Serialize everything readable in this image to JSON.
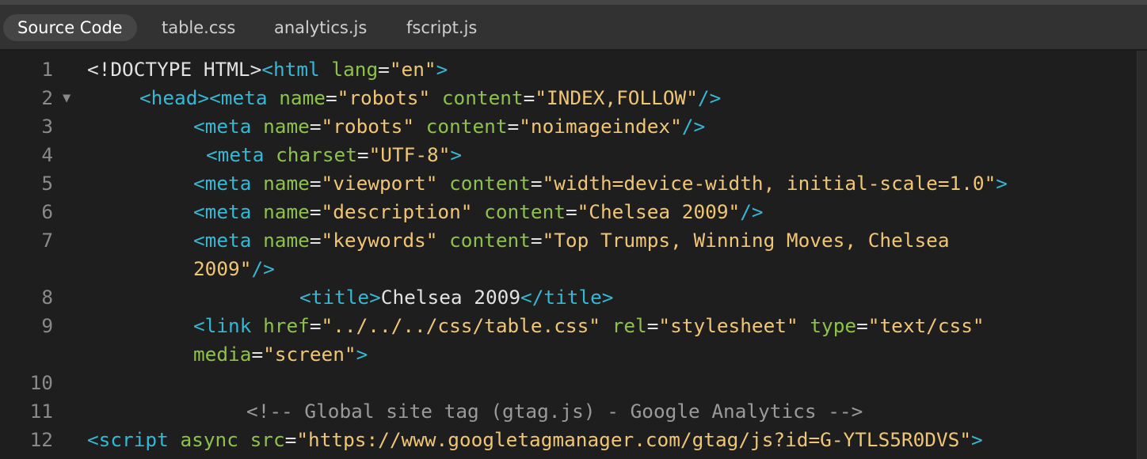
{
  "tabs": [
    {
      "label": "Source Code",
      "active": true
    },
    {
      "label": "table.css",
      "active": false
    },
    {
      "label": "analytics.js",
      "active": false
    },
    {
      "label": "fscript.js",
      "active": false
    }
  ],
  "colors": {
    "background": "#1e1e1e",
    "tag": "#33b8d6",
    "attribute_name": "#8dc24a",
    "attribute_value": "#f0c674",
    "text": "#e2e2e2",
    "comment": "#9a9a9a",
    "line_number": "#8a8a8a"
  },
  "editor": {
    "lines": [
      {
        "number": "1",
        "tokens": [
          {
            "t": "tx",
            "v": "<!DOCTYPE HTML>"
          },
          {
            "t": "tg",
            "v": "<html "
          },
          {
            "t": "an",
            "v": "lang"
          },
          {
            "t": "tx",
            "v": "="
          },
          {
            "t": "av",
            "v": "\"en\""
          },
          {
            "t": "tg",
            "v": ">"
          }
        ]
      },
      {
        "number": "2",
        "fold": "▼",
        "tokens": [
          {
            "t": "tg",
            "v": "<head><meta "
          },
          {
            "t": "an",
            "v": "name"
          },
          {
            "t": "tx",
            "v": "="
          },
          {
            "t": "av",
            "v": "\"robots\" "
          },
          {
            "t": "an",
            "v": "content"
          },
          {
            "t": "tx",
            "v": "="
          },
          {
            "t": "av",
            "v": "\"INDEX,FOLLOW\""
          },
          {
            "t": "tg",
            "v": "/>"
          }
        ]
      },
      {
        "number": "3",
        "tokens": [
          {
            "t": "tg",
            "v": "<meta "
          },
          {
            "t": "an",
            "v": "name"
          },
          {
            "t": "tx",
            "v": "="
          },
          {
            "t": "av",
            "v": "\"robots\" "
          },
          {
            "t": "an",
            "v": "content"
          },
          {
            "t": "tx",
            "v": "="
          },
          {
            "t": "av",
            "v": "\"noimageindex\""
          },
          {
            "t": "tg",
            "v": "/>"
          }
        ]
      },
      {
        "number": "4",
        "tokens": [
          {
            "t": "tg",
            "v": "<meta "
          },
          {
            "t": "an",
            "v": "charset"
          },
          {
            "t": "tx",
            "v": "="
          },
          {
            "t": "av",
            "v": "\"UTF-8\""
          },
          {
            "t": "tg",
            "v": ">"
          }
        ]
      },
      {
        "number": "5",
        "tokens": [
          {
            "t": "tg",
            "v": "<meta "
          },
          {
            "t": "an",
            "v": "name"
          },
          {
            "t": "tx",
            "v": "="
          },
          {
            "t": "av",
            "v": "\"viewport\" "
          },
          {
            "t": "an",
            "v": "content"
          },
          {
            "t": "tx",
            "v": "="
          },
          {
            "t": "av",
            "v": "\"width=device-width, initial-scale=1.0\""
          },
          {
            "t": "tg",
            "v": ">"
          }
        ]
      },
      {
        "number": "6",
        "tokens": [
          {
            "t": "tg",
            "v": "<meta "
          },
          {
            "t": "an",
            "v": "name"
          },
          {
            "t": "tx",
            "v": "="
          },
          {
            "t": "av",
            "v": "\"description\" "
          },
          {
            "t": "an",
            "v": "content"
          },
          {
            "t": "tx",
            "v": "="
          },
          {
            "t": "av",
            "v": "\"Chelsea 2009\""
          },
          {
            "t": "tg",
            "v": "/>"
          }
        ]
      },
      {
        "number": "7",
        "tokens": [
          {
            "t": "tg",
            "v": "<meta "
          },
          {
            "t": "an",
            "v": "name"
          },
          {
            "t": "tx",
            "v": "="
          },
          {
            "t": "av",
            "v": "\"keywords\" "
          },
          {
            "t": "an",
            "v": "content"
          },
          {
            "t": "tx",
            "v": "="
          },
          {
            "t": "av",
            "v": "\"Top Trumps, Winning Moves, Chelsea"
          }
        ]
      },
      {
        "number": "",
        "tokens": [
          {
            "t": "av",
            "v": "2009\""
          },
          {
            "t": "tg",
            "v": "/>"
          }
        ]
      },
      {
        "number": "8",
        "tokens": [
          {
            "t": "tg",
            "v": "<title>"
          },
          {
            "t": "tx",
            "v": "Chelsea 2009"
          },
          {
            "t": "tg",
            "v": "</title>"
          }
        ]
      },
      {
        "number": "9",
        "tokens": [
          {
            "t": "tg",
            "v": "<link "
          },
          {
            "t": "an",
            "v": "href"
          },
          {
            "t": "tx",
            "v": "="
          },
          {
            "t": "av",
            "v": "\"../../../css/table.css\" "
          },
          {
            "t": "an",
            "v": "rel"
          },
          {
            "t": "tx",
            "v": "="
          },
          {
            "t": "av",
            "v": "\"stylesheet\" "
          },
          {
            "t": "an",
            "v": "type"
          },
          {
            "t": "tx",
            "v": "="
          },
          {
            "t": "av",
            "v": "\"text/css\""
          }
        ]
      },
      {
        "number": "",
        "tokens": [
          {
            "t": "an",
            "v": "media"
          },
          {
            "t": "tx",
            "v": "="
          },
          {
            "t": "av",
            "v": "\"screen\""
          },
          {
            "t": "tg",
            "v": ">"
          }
        ]
      },
      {
        "number": "10",
        "tokens": []
      },
      {
        "number": "11",
        "tokens": [
          {
            "t": "cm",
            "v": "<!-- Global site tag (gtag.js) - Google Analytics -->"
          }
        ]
      },
      {
        "number": "12",
        "tokens": [
          {
            "t": "tg",
            "v": "<script "
          },
          {
            "t": "an",
            "v": "async "
          },
          {
            "t": "an",
            "v": "src"
          },
          {
            "t": "tx",
            "v": "="
          },
          {
            "t": "av",
            "v": "\"https://www.googletagmanager.com/gtag/js?id=G-YTLS5R0DVS\""
          },
          {
            "t": "tg",
            "v": ">"
          }
        ]
      }
    ]
  }
}
